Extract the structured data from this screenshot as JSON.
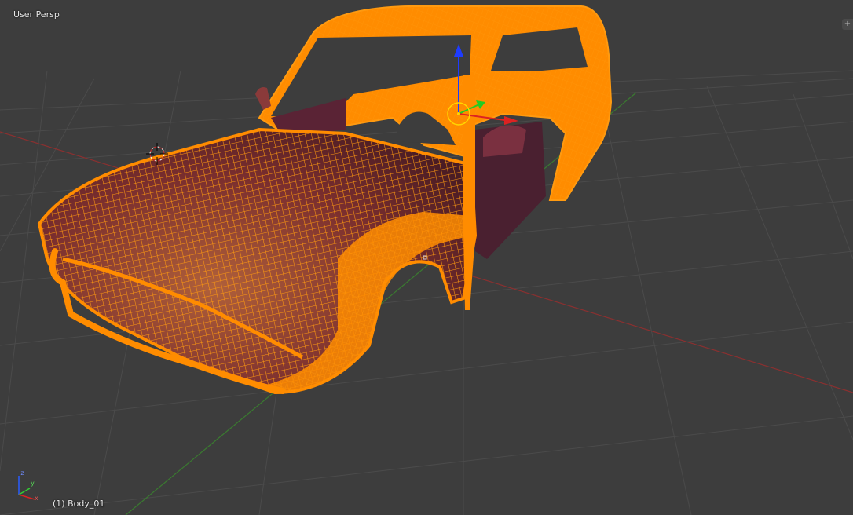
{
  "viewport": {
    "view_name": "User Persp",
    "active_object_label": "(1) Body_01",
    "corner_widget_icon": "plus-icon"
  },
  "axes_widget": {
    "z_label": "z",
    "y_label": "y",
    "x_label": "x"
  },
  "colors": {
    "background": "#3d3d3d",
    "grid": "#4a4a4a",
    "x_axis": "#8a3030",
    "y_axis": "#3a7a30",
    "wire": "#ff8c00",
    "wire_light": "#ffa733",
    "surface": "#7a2e2e",
    "interior": "#4a2030",
    "manipulator_z": "#1e3cff",
    "manipulator_y": "#22cc22",
    "manipulator_x": "#dd2222",
    "pivot": "#ffd700"
  }
}
